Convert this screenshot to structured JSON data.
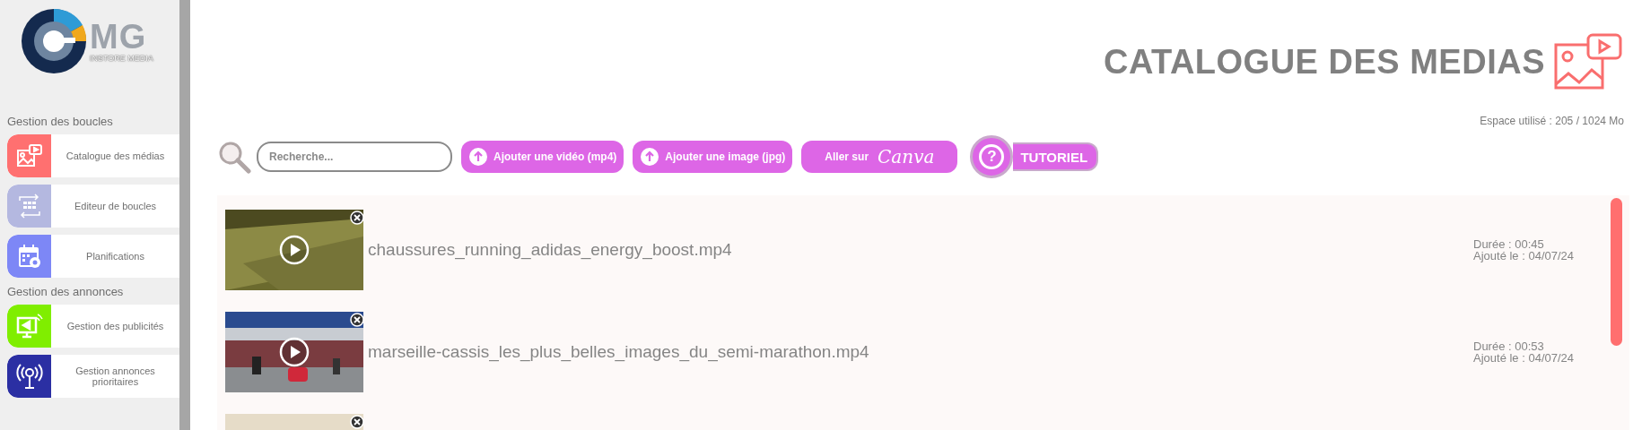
{
  "logo": {
    "letters": "MG",
    "tagline": "INSTORE MEDIA"
  },
  "sidebar": {
    "sections": [
      {
        "title": "Gestion des boucles",
        "items": [
          {
            "label": "Catalogue des médias",
            "color": "#ff7070"
          },
          {
            "label": "Editeur de boucles",
            "color": "#b4b8e0"
          },
          {
            "label": "Planifications",
            "color": "#7d87f6"
          }
        ]
      },
      {
        "title": "Gestion des annonces",
        "items": [
          {
            "label": "Gestion des publicités",
            "color": "#80ee00"
          },
          {
            "label": "Gestion annonces prioritaires",
            "color": "#2b2fa3"
          }
        ]
      }
    ]
  },
  "header": {
    "title": "CATALOGUE DES MEDIAS",
    "storage": "Espace utilisé : 205 / 1024 Mo"
  },
  "toolbar": {
    "search": {
      "placeholder": "Recherche..."
    },
    "buttons": [
      {
        "kind": "upload",
        "label": "Ajouter une vidéo (mp4)"
      },
      {
        "kind": "upload",
        "label": "Ajouter une image (jpg)"
      },
      {
        "kind": "canva",
        "label": "Aller sur",
        "brand": "Canva"
      },
      {
        "kind": "tutorial",
        "label": "TUTORIEL",
        "icon_text": "?"
      }
    ]
  },
  "media": [
    {
      "name": "chaussures_running_adidas_energy_boost.mp4",
      "duration": "Durée : 00:45",
      "added": "Ajouté le : 04/07/24",
      "thumbnail": {
        "kind": "picture"
      }
    },
    {
      "name": "marseille-cassis_les_plus_belles_images_du_semi-marathon.mp4",
      "duration": "Durée : 00:53",
      "added": "Ajouté le : 04/07/24",
      "thumbnail": {
        "kind": "picture"
      }
    },
    {
      "thumbnail": {
        "kind": "picture"
      }
    }
  ]
}
